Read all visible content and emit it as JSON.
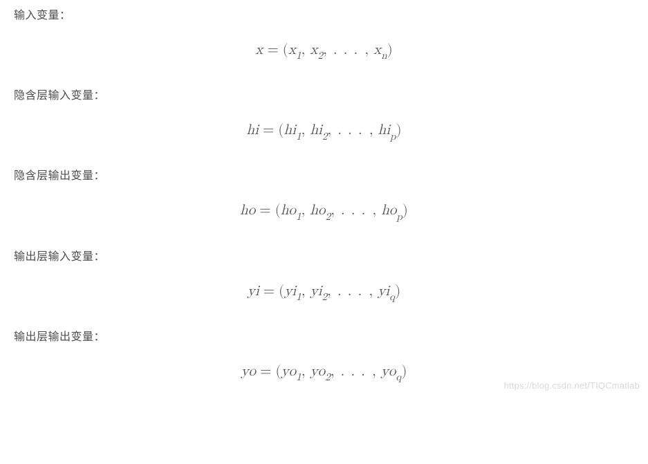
{
  "sections": {
    "input_var": {
      "label": "输入变量：",
      "formula_plain": "x = (x1, x2, ..., xn)"
    },
    "hidden_in": {
      "label": "隐含层输入变量：",
      "formula_plain": "hi = (hi1, hi2, ..., hip)"
    },
    "hidden_out": {
      "label": "隐含层输出变量：",
      "formula_plain": "ho = (ho1, ho2, ..., hop)"
    },
    "output_in": {
      "label": "输出层输入变量：",
      "formula_plain": "yi = (yi1, yi2, ..., yiq)"
    },
    "output_out": {
      "label": "输出层输出变量：",
      "formula_plain": "yo = (yo1, yo2, ..., yoq)"
    }
  },
  "formula_parts": {
    "x": {
      "lhs": "x",
      "t1": "x",
      "s1": "1",
      "t2": "x",
      "s2": "2",
      "t3": "x",
      "s3": "n"
    },
    "hi": {
      "lhs": "hi",
      "t1": "hi",
      "s1": "1",
      "t2": "hi",
      "s2": "2",
      "t3": "hi",
      "s3": "p"
    },
    "ho": {
      "lhs": "ho",
      "t1": "ho",
      "s1": "1",
      "t2": "ho",
      "s2": "2",
      "t3": "ho",
      "s3": "p"
    },
    "yi": {
      "lhs": "yi",
      "t1": "yi",
      "s1": "1",
      "t2": "yi",
      "s2": "2",
      "t3": "yi",
      "s3": "q"
    },
    "yo": {
      "lhs": "yo",
      "t1": "yo",
      "s1": "1",
      "t2": "yo",
      "s2": "2",
      "t3": "yo",
      "s3": "q"
    }
  },
  "symbols": {
    "eq": "=",
    "lp": "(",
    "rp": ")",
    "comma": ",",
    "dots": ". . ."
  },
  "watermark": "https://blog.csdn.net/TIQCmatlab"
}
